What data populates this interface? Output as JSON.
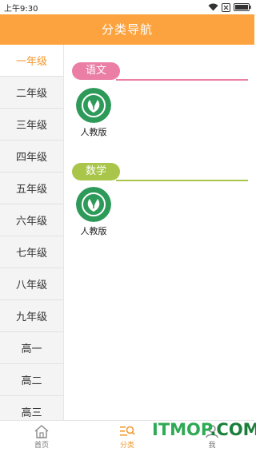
{
  "status_bar": {
    "time": "上午9:30",
    "icons": [
      "wifi-icon",
      "close-box-icon",
      "battery-icon"
    ]
  },
  "header": {
    "title": "分类导航"
  },
  "sidebar": {
    "items": [
      {
        "label": "一年级",
        "active": true
      },
      {
        "label": "二年级",
        "active": false
      },
      {
        "label": "三年级",
        "active": false
      },
      {
        "label": "四年级",
        "active": false
      },
      {
        "label": "五年级",
        "active": false
      },
      {
        "label": "六年级",
        "active": false
      },
      {
        "label": "七年级",
        "active": false
      },
      {
        "label": "八年级",
        "active": false
      },
      {
        "label": "九年级",
        "active": false
      },
      {
        "label": "高一",
        "active": false
      },
      {
        "label": "高二",
        "active": false
      },
      {
        "label": "高三",
        "active": false
      }
    ]
  },
  "sections": [
    {
      "title": "语文",
      "color": "#ea7ea4",
      "books": [
        {
          "label": "人教版",
          "icon": "pep-logo-icon"
        }
      ]
    },
    {
      "title": "数学",
      "color": "#a9c64a",
      "books": [
        {
          "label": "人教版",
          "icon": "pep-logo-icon"
        }
      ]
    }
  ],
  "tabs": [
    {
      "label": "首页",
      "icon": "home-icon",
      "active": false
    },
    {
      "label": "分类",
      "icon": "category-search-icon",
      "active": true
    },
    {
      "label": "我",
      "icon": "person-icon",
      "active": false
    }
  ],
  "watermark": {
    "text_main": "ITMOP",
    "text_dark": ".COM"
  },
  "colors": {
    "accent": "#fca33f",
    "active_text": "#f39a2e",
    "logo_green": "#2e9a5a"
  }
}
